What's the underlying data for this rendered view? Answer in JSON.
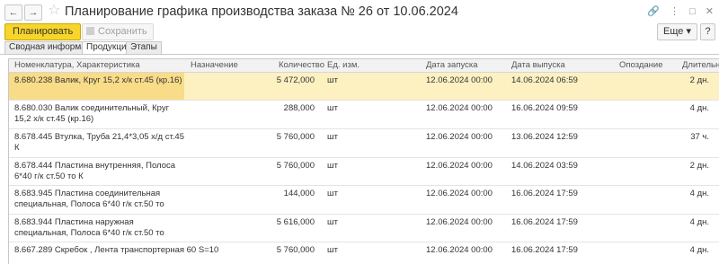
{
  "window": {
    "title": "Планирование графика производства заказа № 26 от 10.06.2024",
    "back_icon": "←",
    "forward_icon": "→",
    "star_icon": "☆",
    "link_icon": "🔗",
    "menu_icon": "⋮",
    "maximize_icon": "□",
    "close_icon": "✕"
  },
  "toolbar": {
    "plan_label": "Планировать",
    "save_label": "Сохранить",
    "more_label": "Еще ▾",
    "help_label": "?"
  },
  "tabs": [
    {
      "label": "Сводная информация",
      "active": false
    },
    {
      "label": "Продукция",
      "active": true
    },
    {
      "label": "Этапы",
      "active": false
    }
  ],
  "table": {
    "columns": [
      "Номенклатура, Характеристика",
      "Назначение",
      "Количество",
      "Ед. изм.",
      "Дата запуска",
      "Дата выпуска",
      "Опоздание",
      "Длительность"
    ],
    "rows": [
      {
        "name": "8.680.238 Валик, Круг 15,2 х/к ст.45 (кр.16)",
        "purpose": "",
        "qty": "5 472,000",
        "unit": "шт",
        "start": "12.06.2024 00:00",
        "end": "14.06.2024 06:59",
        "delay": "",
        "duration": "2 дн."
      },
      {
        "name": "8.680.030 Валик соединительный, Круг 15,2 х/к ст.45 (кр.16)",
        "purpose": "",
        "qty": "288,000",
        "unit": "шт",
        "start": "12.06.2024 00:00",
        "end": "16.06.2024 09:59",
        "delay": "",
        "duration": "4 дн."
      },
      {
        "name": "8.678.445 Втулка, Труба 21,4*3,05 х/д ст.45 К",
        "purpose": "",
        "qty": "5 760,000",
        "unit": "шт",
        "start": "12.06.2024 00:00",
        "end": "13.06.2024 12:59",
        "delay": "",
        "duration": "37 ч."
      },
      {
        "name": "8.678.444 Пластина внутренняя, Полоса 6*40 г/к ст.50 то  К",
        "purpose": "",
        "qty": "5 760,000",
        "unit": "шт",
        "start": "12.06.2024 00:00",
        "end": "14.06.2024 03:59",
        "delay": "",
        "duration": "2 дн."
      },
      {
        "name": "8.683.945 Пластина соединительная специальная, Полоса 6*40 г/к ст.50 то",
        "purpose": "",
        "qty": "144,000",
        "unit": "шт",
        "start": "12.06.2024 00:00",
        "end": "16.06.2024 17:59",
        "delay": "",
        "duration": "4 дн."
      },
      {
        "name": "8.683.944 Пластина наружная специальная, Полоса 6*40 г/к ст.50 то",
        "purpose": "",
        "qty": "5 616,000",
        "unit": "шт",
        "start": "12.06.2024 00:00",
        "end": "16.06.2024 17:59",
        "delay": "",
        "duration": "4 дн."
      },
      {
        "name": "8.667.289 Скребок , Лента транспортерная 60 S=10",
        "purpose": "",
        "qty": "5 760,000",
        "unit": "шт",
        "start": "12.06.2024 00:00",
        "end": "16.06.2024 17:59",
        "delay": "",
        "duration": "4 дн."
      }
    ]
  },
  "colors": {
    "primary_button": "#f7d52a",
    "selected_row": "#fdf1c2"
  }
}
